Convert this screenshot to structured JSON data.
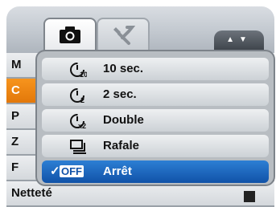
{
  "tabs": [
    {
      "icon": "camera-icon"
    },
    {
      "icon": "wrench-screwdriver-icon"
    }
  ],
  "scroll_arrows": "▲▼",
  "background_menu": {
    "items": [
      "M",
      "C",
      "P",
      "Z",
      "F",
      "Netteté"
    ],
    "selected_index": 1
  },
  "popup": {
    "options": [
      {
        "label": "10 sec.",
        "icon": "self-timer-10-icon"
      },
      {
        "label": "2 sec.",
        "icon": "self-timer-2-icon"
      },
      {
        "label": "Double",
        "icon": "self-timer-double-icon"
      },
      {
        "label": "Rafale",
        "icon": "burst-icon"
      },
      {
        "label": "Arrêt",
        "icon": "off-icon",
        "badge": "OFF",
        "check": "✓"
      }
    ],
    "selected_index": 4
  },
  "colors": {
    "selection_blue": "#1052a8",
    "highlight_orange": "#e2780a"
  }
}
